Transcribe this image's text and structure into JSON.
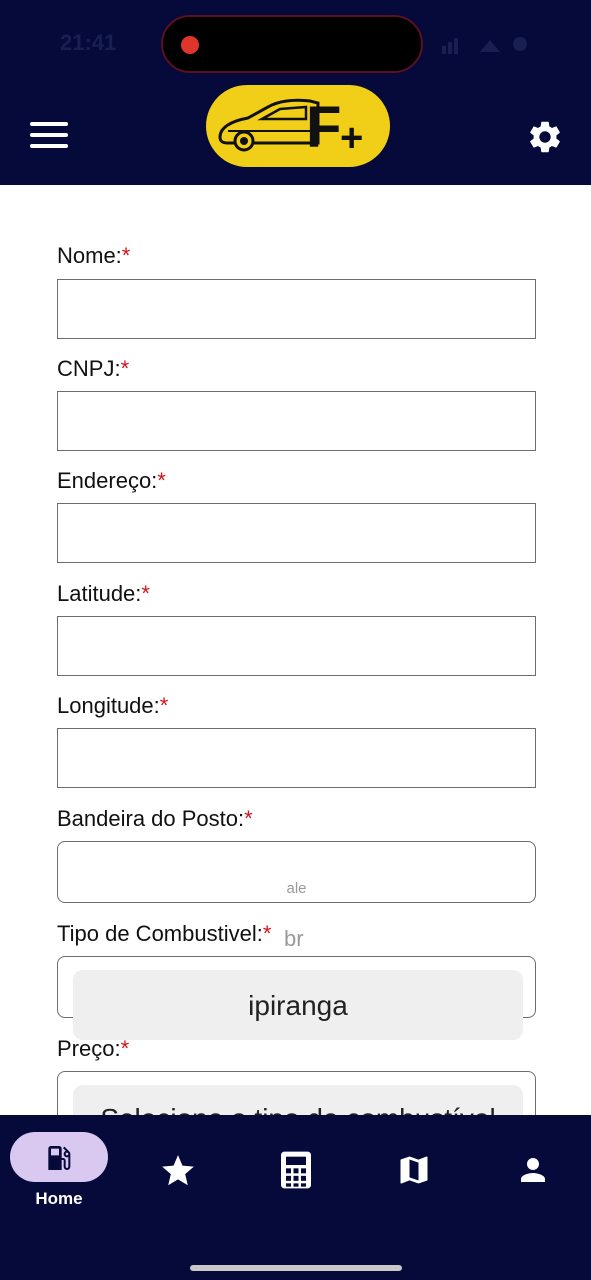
{
  "status_bar": {
    "time": "21:41"
  },
  "header": {
    "logo_text": "F+"
  },
  "form": {
    "fields": [
      {
        "label": "Nome:",
        "required_mark": "*"
      },
      {
        "label": "CNPJ:",
        "required_mark": "*"
      },
      {
        "label": "Endereço:",
        "required_mark": "*"
      },
      {
        "label": "Latitude:",
        "required_mark": "*"
      },
      {
        "label": "Longitude:",
        "required_mark": "*"
      },
      {
        "label": "Bandeira do Posto:",
        "required_mark": "*"
      },
      {
        "label": "Tipo de Combustivel:",
        "required_mark": "*"
      },
      {
        "label": "Preço:",
        "required_mark": "*"
      }
    ],
    "bandeira_picker": {
      "option_above": "ale",
      "option_partial": "br",
      "selected": "ipiranga"
    },
    "tipo_picker": {
      "partial_text": "Selecione o tipo de combustível"
    }
  },
  "tabbar": {
    "home_label": "Home",
    "tabs": [
      "fuel-icon",
      "star-icon",
      "calculator-icon",
      "map-icon",
      "person-icon"
    ]
  },
  "colors": {
    "nav_bg": "#060a3a",
    "logo_yellow": "#f1cf18",
    "required": "#d0141c",
    "active_pill": "#d9c8f0"
  }
}
